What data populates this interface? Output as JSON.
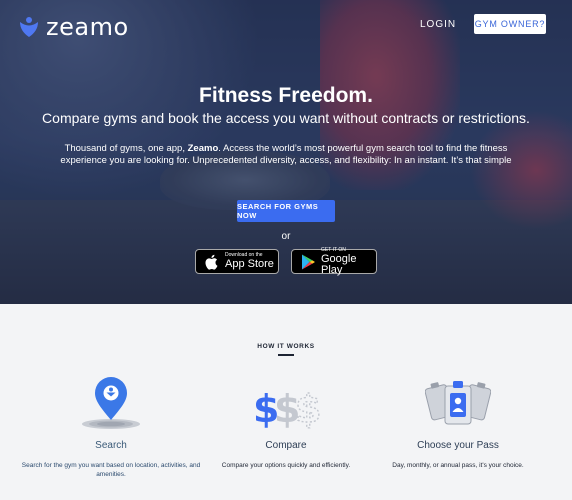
{
  "header": {
    "brand": "zeamo",
    "login_label": "LOGIN",
    "gym_owner_label": "GYM OWNER?"
  },
  "hero": {
    "title": "Fitness Freedom.",
    "subtitle": "Compare gyms and book the access you want without contracts or restrictions.",
    "paragraph_before": "Thousand of gyms, one app, ",
    "paragraph_brand": "Zeamo",
    "paragraph_after": ". Access the world’s most powerful gym search tool to find the fitness experience you are looking for. Unprecedented diversity, access, and flexibility: In an instant. It’s that simple",
    "cta_label": "SEARCH FOR GYMS NOW",
    "or_label": "or",
    "app_store": {
      "small": "Download on the",
      "big": "App Store"
    },
    "google_play": {
      "small": "GET IT ON",
      "big": "Google Play"
    }
  },
  "how_it_works": {
    "title": "HOW IT WORKS",
    "steps": [
      {
        "name": "Search",
        "description": "Search for the gym you want based on location, activities, and amenities.",
        "icon": "map-pin-icon"
      },
      {
        "name": "Compare",
        "description": "Compare your options quickly and efficiently.",
        "icon": "dollar-signs-icon"
      },
      {
        "name": "Choose your Pass",
        "description": "Day, monthly, or annual pass, it's your choice.",
        "icon": "pass-cards-icon"
      }
    ]
  },
  "colors": {
    "brand_blue": "#3b6cf0",
    "owner_text": "#3a66d8"
  }
}
